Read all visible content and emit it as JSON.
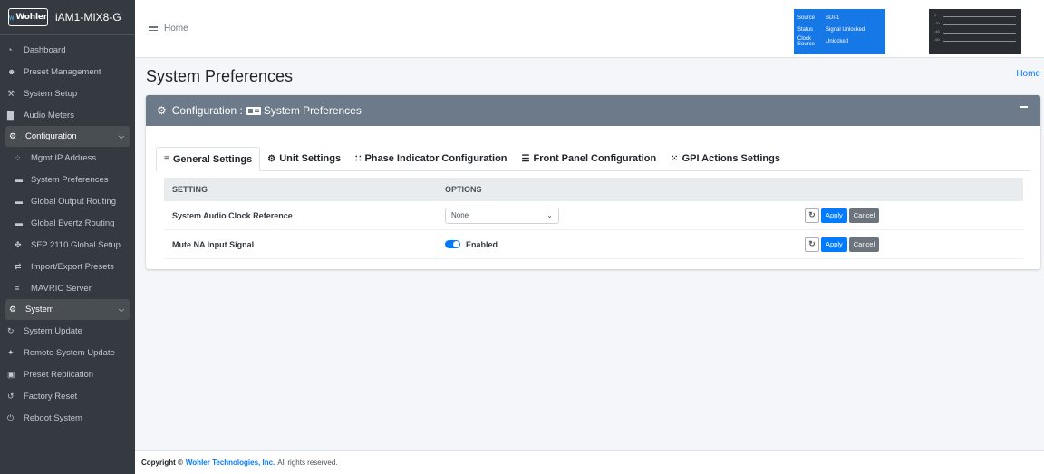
{
  "sidebar": {
    "brand": {
      "logo_text": "Wohler",
      "name": "iAM1-MIX8-G"
    },
    "items": [
      {
        "label": "Dashboard",
        "icon": "tachometer-icon",
        "glyph": "◔"
      },
      {
        "label": "Preset Management",
        "icon": "users-icon",
        "glyph": "☻"
      },
      {
        "label": "System Setup",
        "icon": "tools-icon",
        "glyph": "⚒"
      },
      {
        "label": "Audio Meters",
        "icon": "bar-chart-icon",
        "glyph": "▇"
      }
    ],
    "configuration": {
      "label": "Configuration",
      "icon": "gear-icon",
      "glyph": "⚙",
      "items": [
        {
          "label": "Mgmt IP Address",
          "icon": "network-icon",
          "glyph": "⁘"
        },
        {
          "label": "System Preferences",
          "icon": "id-card-icon",
          "glyph": "▬"
        },
        {
          "label": "Global Output Routing",
          "icon": "id-card-icon",
          "glyph": "▬"
        },
        {
          "label": "Global Evertz Routing",
          "icon": "id-card-icon",
          "glyph": "▬"
        },
        {
          "label": "SFP 2110 Global Setup",
          "icon": "tool-icon",
          "glyph": "✤"
        },
        {
          "label": "Import/Export Presets",
          "icon": "exchange-icon",
          "glyph": "⇄"
        },
        {
          "label": "MAVRIC Server",
          "icon": "server-icon",
          "glyph": "≡"
        }
      ]
    },
    "system": {
      "label": "System",
      "icon": "cogs-icon",
      "glyph": "⚙",
      "items": [
        {
          "label": "System Update",
          "icon": "sync-icon",
          "glyph": "↻"
        },
        {
          "label": "Remote System Update",
          "icon": "satellite-icon",
          "glyph": "✦"
        },
        {
          "label": "Preset Replication",
          "icon": "clone-icon",
          "glyph": "▣"
        },
        {
          "label": "Factory Reset",
          "icon": "undo-icon",
          "glyph": "↺"
        },
        {
          "label": "Reboot System",
          "icon": "power-icon",
          "glyph": "⏻"
        }
      ]
    }
  },
  "topbar": {
    "home_label": "Home",
    "status": {
      "source_key": "Source",
      "source_val": "SDI-1",
      "status_key": "Status",
      "status_val": "Signal Unlocked",
      "clock_key": "Clock Source",
      "clock_val": "Unlocked"
    },
    "meter_labels": [
      "0",
      "-20",
      "-40",
      "-60"
    ]
  },
  "content": {
    "page_title": "System Preferences",
    "breadcrumb": "Home",
    "card_title_prefix": "Configuration :",
    "card_title": "System Preferences",
    "tabs": [
      {
        "label": "General Settings",
        "icon": "list-icon",
        "glyph": "≡",
        "active": true
      },
      {
        "label": "Unit Settings",
        "icon": "cogs-icon",
        "glyph": "⚙",
        "active": false
      },
      {
        "label": "Phase Indicator Configuration",
        "icon": "grid-icon",
        "glyph": "∷",
        "active": false
      },
      {
        "label": "Front Panel Configuration",
        "icon": "list-icon",
        "glyph": "☰",
        "active": false
      },
      {
        "label": "GPI Actions Settings",
        "icon": "dots-icon",
        "glyph": "⁙",
        "active": false
      }
    ],
    "table": {
      "headers": [
        "SETTING",
        "OPTIONS"
      ],
      "rows": [
        {
          "setting": "System Audio Clock Reference",
          "type": "select",
          "value": "None"
        },
        {
          "setting": "Mute NA Input Signal",
          "type": "toggle",
          "value": "Enabled",
          "on": true
        }
      ],
      "apply_label": "Apply",
      "cancel_label": "Cancel"
    }
  },
  "footer": {
    "prefix": "Copyright ©",
    "company": "Wohler Technologies, Inc.",
    "suffix": "All rights reserved."
  },
  "colors": {
    "sidebar_bg": "#343a40",
    "card_header": "#6c7a89",
    "status_box": "#1677e6",
    "accent": "#007bff"
  }
}
